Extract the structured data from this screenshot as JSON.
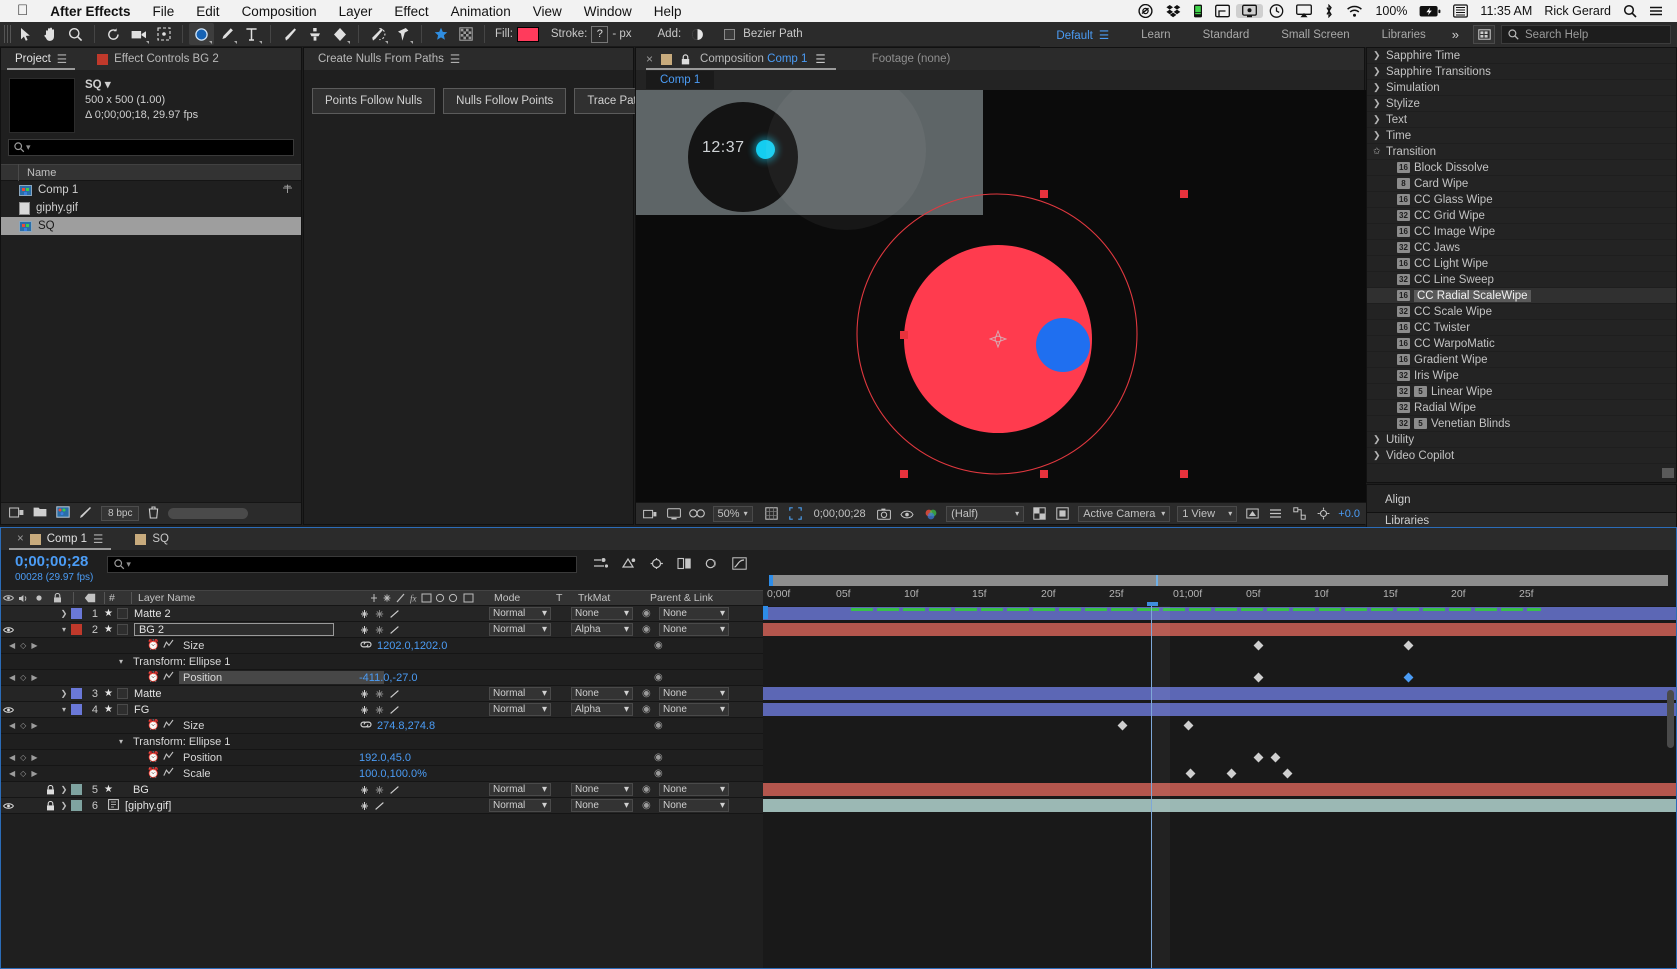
{
  "macbar": {
    "apple": "apple-logo",
    "menus": [
      "After Effects",
      "File",
      "Edit",
      "Composition",
      "Layer",
      "Effect",
      "Animation",
      "View",
      "Window",
      "Help"
    ],
    "battery": "100%",
    "time": "11:35 AM",
    "user": "Rick Gerard",
    "status_icons": [
      "creative-cloud-icon",
      "dropbox-icon",
      "battery-meter-icon",
      "window-icon",
      "display-icon",
      "time-machine-icon",
      "airplay-icon",
      "bluetooth-icon",
      "wifi-icon",
      "battery-charging-icon",
      "keyboard-input-icon"
    ]
  },
  "toolbar": {
    "tools": [
      "selection-tool",
      "hand-tool",
      "zoom-tool",
      "rotation-tool",
      "camera-tool",
      "anchor-point-tool",
      "shape-tool",
      "pen-tool",
      "type-tool",
      "brush-tool",
      "clone-stamp-tool",
      "eraser-tool",
      "roto-brush-tool",
      "puppet-pin-tool"
    ],
    "fill_label": "Fill:",
    "fill_color": "#ff3b5c",
    "stroke_label": "Stroke:",
    "stroke_value": "?",
    "stroke_units": "- px",
    "add_label": "Add:",
    "bezier_label": "Bezier Path"
  },
  "workspaces": {
    "items": [
      "Default",
      "Learn",
      "Standard",
      "Small Screen",
      "Libraries"
    ],
    "active": "Default",
    "overflow": "»",
    "search_placeholder": "Search Help"
  },
  "project": {
    "tab": "Project",
    "effect_controls_tab": "Effect Controls BG 2",
    "item_name": "SQ",
    "dimensions": "500 x 500 (1.00)",
    "duration": "Δ 0;00;00;18, 29.97 fps",
    "search_placeholder": "",
    "column_name": "Name",
    "items": [
      {
        "name": "Comp 1",
        "icon": "composition-icon",
        "selected": false
      },
      {
        "name": "giphy.gif",
        "icon": "file-icon",
        "selected": false
      },
      {
        "name": "SQ",
        "icon": "composition-icon",
        "selected": true
      }
    ],
    "bit_depth": "8 bpc"
  },
  "nulls_panel": {
    "title": "Create Nulls From Paths",
    "buttons": [
      "Points Follow Nulls",
      "Nulls Follow Points",
      "Trace Path"
    ]
  },
  "composition": {
    "tab_close": "×",
    "tab_prefix": "Composition",
    "tab_name": "Comp 1",
    "footage_tab": "Footage (none)",
    "subtab": "Comp 1",
    "magnification": "50%",
    "timecode": "0;00;00;28",
    "resolution": "(Half)",
    "camera": "Active Camera",
    "views": "1 View",
    "exposure": "+0.0",
    "clock_text": "12:37"
  },
  "effects_panel": {
    "groups_above": [
      "Sapphire Time",
      "Sapphire Transitions",
      "Simulation",
      "Stylize",
      "Text",
      "Time"
    ],
    "open_group": "Transition",
    "effects": [
      {
        "name": "Block Dissolve",
        "bits": "16"
      },
      {
        "name": "Card Wipe",
        "bits": "8"
      },
      {
        "name": "CC Glass Wipe",
        "bits": "16"
      },
      {
        "name": "CC Grid Wipe",
        "bits": "32"
      },
      {
        "name": "CC Image Wipe",
        "bits": "16"
      },
      {
        "name": "CC Jaws",
        "bits": "32"
      },
      {
        "name": "CC Light Wipe",
        "bits": "16"
      },
      {
        "name": "CC Line Sweep",
        "bits": "32"
      },
      {
        "name": "CC Radial ScaleWipe",
        "bits": "16",
        "highlighted": true
      },
      {
        "name": "CC Scale Wipe",
        "bits": "32"
      },
      {
        "name": "CC Twister",
        "bits": "16"
      },
      {
        "name": "CC WarpoMatic",
        "bits": "16"
      },
      {
        "name": "Gradient Wipe",
        "bits": "16"
      },
      {
        "name": "Iris Wipe",
        "bits": "32"
      },
      {
        "name": "Linear Wipe",
        "bits": "32",
        "gpu": true
      },
      {
        "name": "Radial Wipe",
        "bits": "32"
      },
      {
        "name": "Venetian Blinds",
        "bits": "32",
        "gpu": true
      }
    ],
    "groups_below": [
      "Utility",
      "Video Copilot"
    ],
    "align_title": "Align",
    "libraries_title": "Libraries"
  },
  "timeline": {
    "tabs": [
      {
        "label": "Comp 1",
        "selected": true
      },
      {
        "label": "SQ",
        "selected": false
      }
    ],
    "current_time": "0;00;00;28",
    "frame_info": "00028 (29.97 fps)",
    "search_placeholder": "",
    "columns": [
      "#",
      "Layer Name",
      "Mode",
      "T",
      "TrkMat",
      "Parent & Link"
    ],
    "ruler_ticks": [
      "0;00f",
      "05f",
      "10f",
      "15f",
      "20f",
      "25f",
      "01;00f",
      "05f",
      "10f",
      "15f",
      "20f",
      "25f"
    ],
    "rows": [
      {
        "type": "layer",
        "num": "1",
        "name": "Matte 2",
        "color": "#6a78d8",
        "mode": "Normal",
        "trkmat": "None",
        "parent": "None",
        "visible": false,
        "locked": false,
        "expanded": false,
        "bar": "#5c67b5"
      },
      {
        "type": "layer",
        "num": "2",
        "name": "BG 2",
        "color": "#c0392b",
        "mode": "Normal",
        "trkmat": "Alpha",
        "parent": "None",
        "visible": true,
        "locked": false,
        "expanded": true,
        "renaming": true,
        "bar": "#b4564d"
      },
      {
        "type": "prop",
        "name": "Size",
        "value": "1202.0,1202.0",
        "linked": true,
        "stopwatch": true
      },
      {
        "type": "group",
        "name": "Transform: Ellipse 1"
      },
      {
        "type": "prop",
        "name": "Position",
        "value": "-411.0,-27.0",
        "stopwatch": true,
        "selected": true
      },
      {
        "type": "layer",
        "num": "3",
        "name": "Matte",
        "color": "#6a78d8",
        "mode": "Normal",
        "trkmat": "None",
        "parent": "None",
        "visible": false,
        "locked": false,
        "expanded": false,
        "bar": "#5c67b5"
      },
      {
        "type": "layer",
        "num": "4",
        "name": "FG",
        "color": "#6a78d8",
        "mode": "Normal",
        "trkmat": "Alpha",
        "parent": "None",
        "visible": true,
        "locked": false,
        "expanded": true,
        "bar": "#5c67b5"
      },
      {
        "type": "prop",
        "name": "Size",
        "value": "274.8,274.8",
        "linked": true,
        "stopwatch": true
      },
      {
        "type": "group",
        "name": "Transform: Ellipse 1"
      },
      {
        "type": "prop",
        "name": "Position",
        "value": "192.0,45.0",
        "stopwatch": true
      },
      {
        "type": "prop",
        "name": "Scale",
        "value": "100.0,100.0%",
        "stopwatch": true
      },
      {
        "type": "layer",
        "num": "5",
        "name": "BG",
        "color": "#7fa3a0",
        "mode": "Normal",
        "trkmat": "None",
        "parent": "None",
        "visible": false,
        "locked": true,
        "expanded": false,
        "bar": "#b4564d"
      },
      {
        "type": "layer",
        "num": "6",
        "name": "[giphy.gif]",
        "color": "#7fa3a0",
        "mode": "Normal",
        "trkmat": "None",
        "parent": "None",
        "visible": true,
        "locked": true,
        "expanded": false,
        "bar": "#9bb8b4"
      }
    ]
  }
}
